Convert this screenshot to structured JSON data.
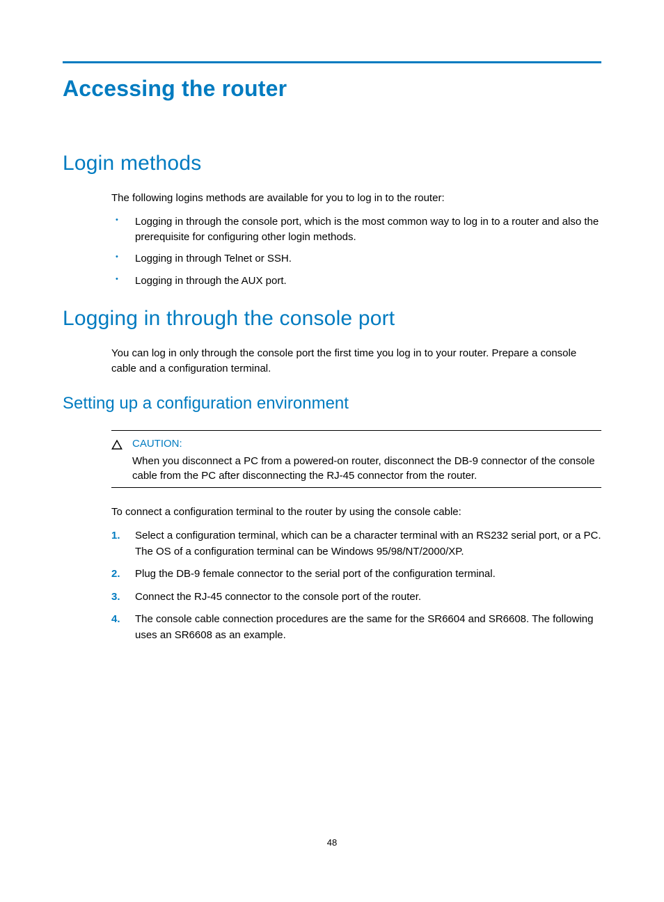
{
  "title": "Accessing the router",
  "sections": {
    "login_methods": {
      "heading": "Login methods",
      "intro": "The following logins methods are available for you to log in to the router:",
      "bullets": [
        "Logging in through the console port, which is the most common way to log in to a router and also the prerequisite for configuring other login methods.",
        "Logging in through Telnet or SSH.",
        "Logging in through the AUX port."
      ]
    },
    "console_port": {
      "heading": "Logging in through the console port",
      "intro": "You can log in only through the console port the first time you log in to your router. Prepare a console cable and a configuration terminal.",
      "subsection": {
        "heading": "Setting up a configuration environment",
        "caution": {
          "label": "CAUTION:",
          "text": "When you disconnect a PC from a powered-on router, disconnect the DB-9 connector of the console cable from the PC after disconnecting the RJ-45 connector from the router."
        },
        "lead": "To connect a configuration terminal to the router by using the console cable:",
        "steps": [
          "Select a configuration terminal, which can be a character terminal with an RS232 serial port, or a PC. The OS of a configuration terminal can be Windows 95/98/NT/2000/XP.",
          "Plug the DB-9 female connector to the serial port of the configuration terminal.",
          "Connect the RJ-45 connector to the console port of the router.",
          "The console cable connection procedures are the same for the SR6604 and SR6608. The following uses an SR6608 as an example."
        ]
      }
    }
  },
  "page_number": "48"
}
